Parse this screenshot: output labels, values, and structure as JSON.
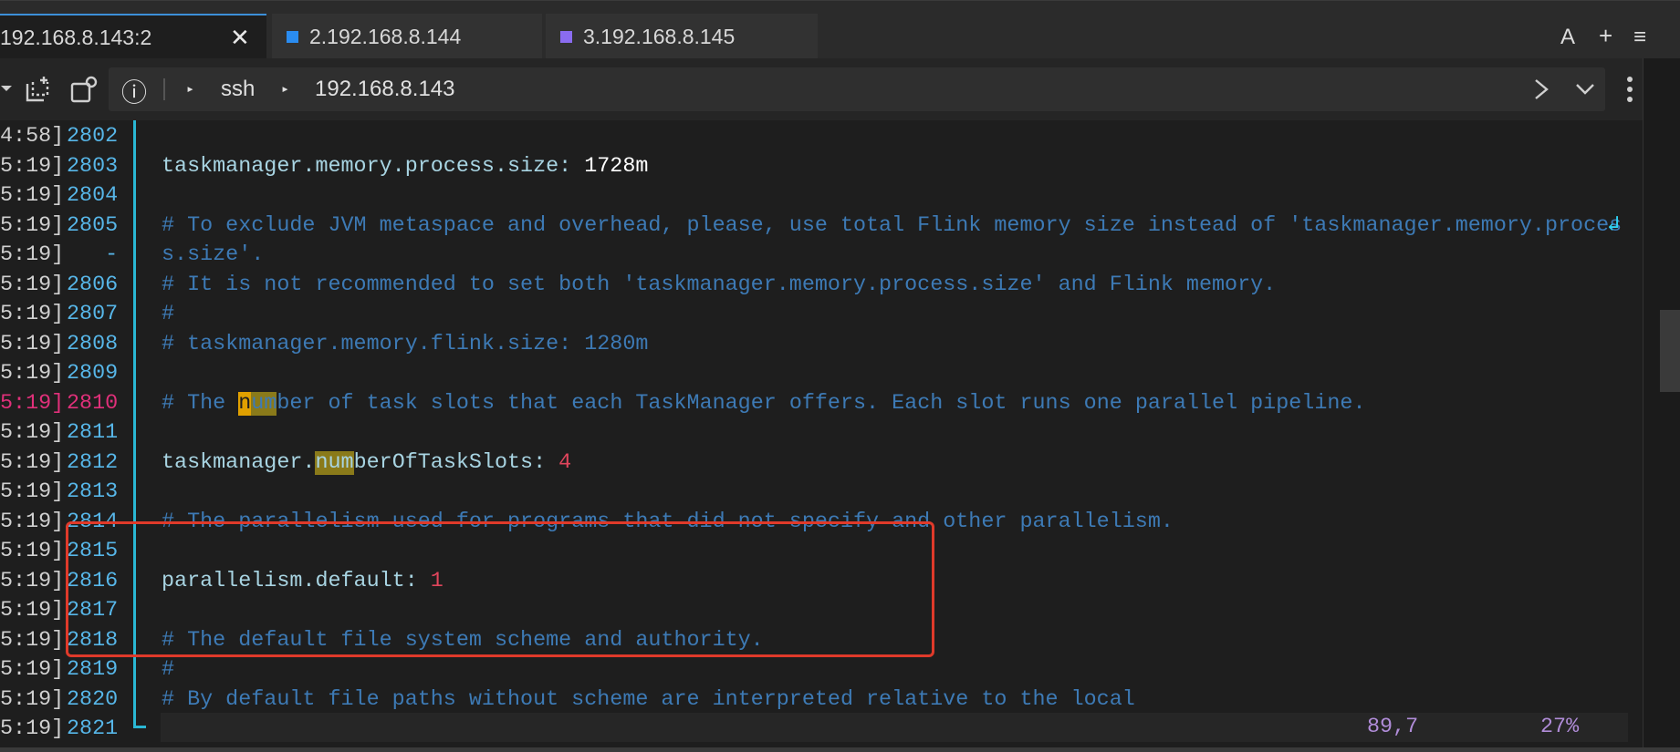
{
  "tabs": [
    {
      "label": "192.168.8.143:2",
      "close": "✕",
      "active": true
    },
    {
      "label": "2.192.168.8.144",
      "color": "#2a8cf0"
    },
    {
      "label": "3.192.168.8.145",
      "color": "#8a6cf0"
    }
  ],
  "tab_actions": {
    "font": "A",
    "add": "+",
    "menu": "≡"
  },
  "address": {
    "protocol": "ssh",
    "host": "192.168.8.143",
    "info": "ⓘ"
  },
  "lines": [
    {
      "ts": "4:58]",
      "ln": "2802",
      "parts": []
    },
    {
      "ts": "5:19]",
      "ln": "2803",
      "parts": [
        {
          "c": "key",
          "t": "taskmanager.memory.process.size"
        },
        {
          "c": "punc",
          "t": ": "
        },
        {
          "c": "val",
          "t": "1728m"
        }
      ]
    },
    {
      "ts": "5:19]",
      "ln": "2804",
      "parts": []
    },
    {
      "ts": "5:19]",
      "ln": "2805",
      "parts": [
        {
          "c": "cmt",
          "t": "# To exclude JVM metaspace and overhead, please, use total Flink memory size instead of 'taskmanager.memory.proces"
        }
      ],
      "wrap": "↲"
    },
    {
      "ts": "5:19]",
      "ln": "   -",
      "parts": [
        {
          "c": "cmt",
          "t": "s.size'."
        }
      ]
    },
    {
      "ts": "5:19]",
      "ln": "2806",
      "parts": [
        {
          "c": "cmt",
          "t": "# It is not recommended to set both 'taskmanager.memory.process.size' and Flink memory."
        }
      ]
    },
    {
      "ts": "5:19]",
      "ln": "2807",
      "parts": [
        {
          "c": "cmt",
          "t": "#"
        }
      ]
    },
    {
      "ts": "5:19]",
      "ln": "2808",
      "parts": [
        {
          "c": "cmt",
          "t": "# taskmanager.memory.flink.size: 1280m"
        }
      ]
    },
    {
      "ts": "5:19]",
      "ln": "2809",
      "parts": []
    },
    {
      "ts": "5:19]",
      "ln": "2810",
      "parts": [
        {
          "c": "cmt",
          "t": "# The "
        },
        {
          "c": "cmt hl-cur",
          "t": "n"
        },
        {
          "c": "cmt hl",
          "t": "um"
        },
        {
          "c": "cmt",
          "t": "ber of task slots that each TaskManager offers. Each slot runs one parallel pipeline."
        }
      ],
      "current": true
    },
    {
      "ts": "5:19]",
      "ln": "2811",
      "parts": []
    },
    {
      "ts": "5:19]",
      "ln": "2812",
      "parts": [
        {
          "c": "key",
          "t": "taskmanager."
        },
        {
          "c": "key hl",
          "t": "num"
        },
        {
          "c": "key",
          "t": "berOfTaskSlots"
        },
        {
          "c": "punc",
          "t": ": "
        },
        {
          "c": "num",
          "t": "4"
        }
      ]
    },
    {
      "ts": "5:19]",
      "ln": "2813",
      "parts": []
    },
    {
      "ts": "5:19]",
      "ln": "2814",
      "parts": [
        {
          "c": "cmt",
          "t": "# The parallelism used for programs that did not specify and other parallelism."
        }
      ]
    },
    {
      "ts": "5:19]",
      "ln": "2815",
      "parts": []
    },
    {
      "ts": "5:19]",
      "ln": "2816",
      "parts": [
        {
          "c": "key",
          "t": "parallelism.default"
        },
        {
          "c": "punc",
          "t": ": "
        },
        {
          "c": "num",
          "t": "1"
        }
      ]
    },
    {
      "ts": "5:19]",
      "ln": "2817",
      "parts": []
    },
    {
      "ts": "5:19]",
      "ln": "2818",
      "parts": [
        {
          "c": "cmt",
          "t": "# The default file system scheme and authority."
        }
      ]
    },
    {
      "ts": "5:19]",
      "ln": "2819",
      "parts": [
        {
          "c": "cmt",
          "t": "#"
        }
      ]
    },
    {
      "ts": "5:19]",
      "ln": "2820",
      "parts": [
        {
          "c": "cmt",
          "t": "# By default file paths without scheme are interpreted relative to the local"
        }
      ]
    },
    {
      "ts": "5:19]",
      "ln": "2821",
      "parts": []
    }
  ],
  "status": {
    "position": "89,7",
    "percent": "27%"
  },
  "colors": {
    "accent": "#2ab7d4",
    "highlight_box": "#e03a2a",
    "current_line": "#e0307a"
  }
}
